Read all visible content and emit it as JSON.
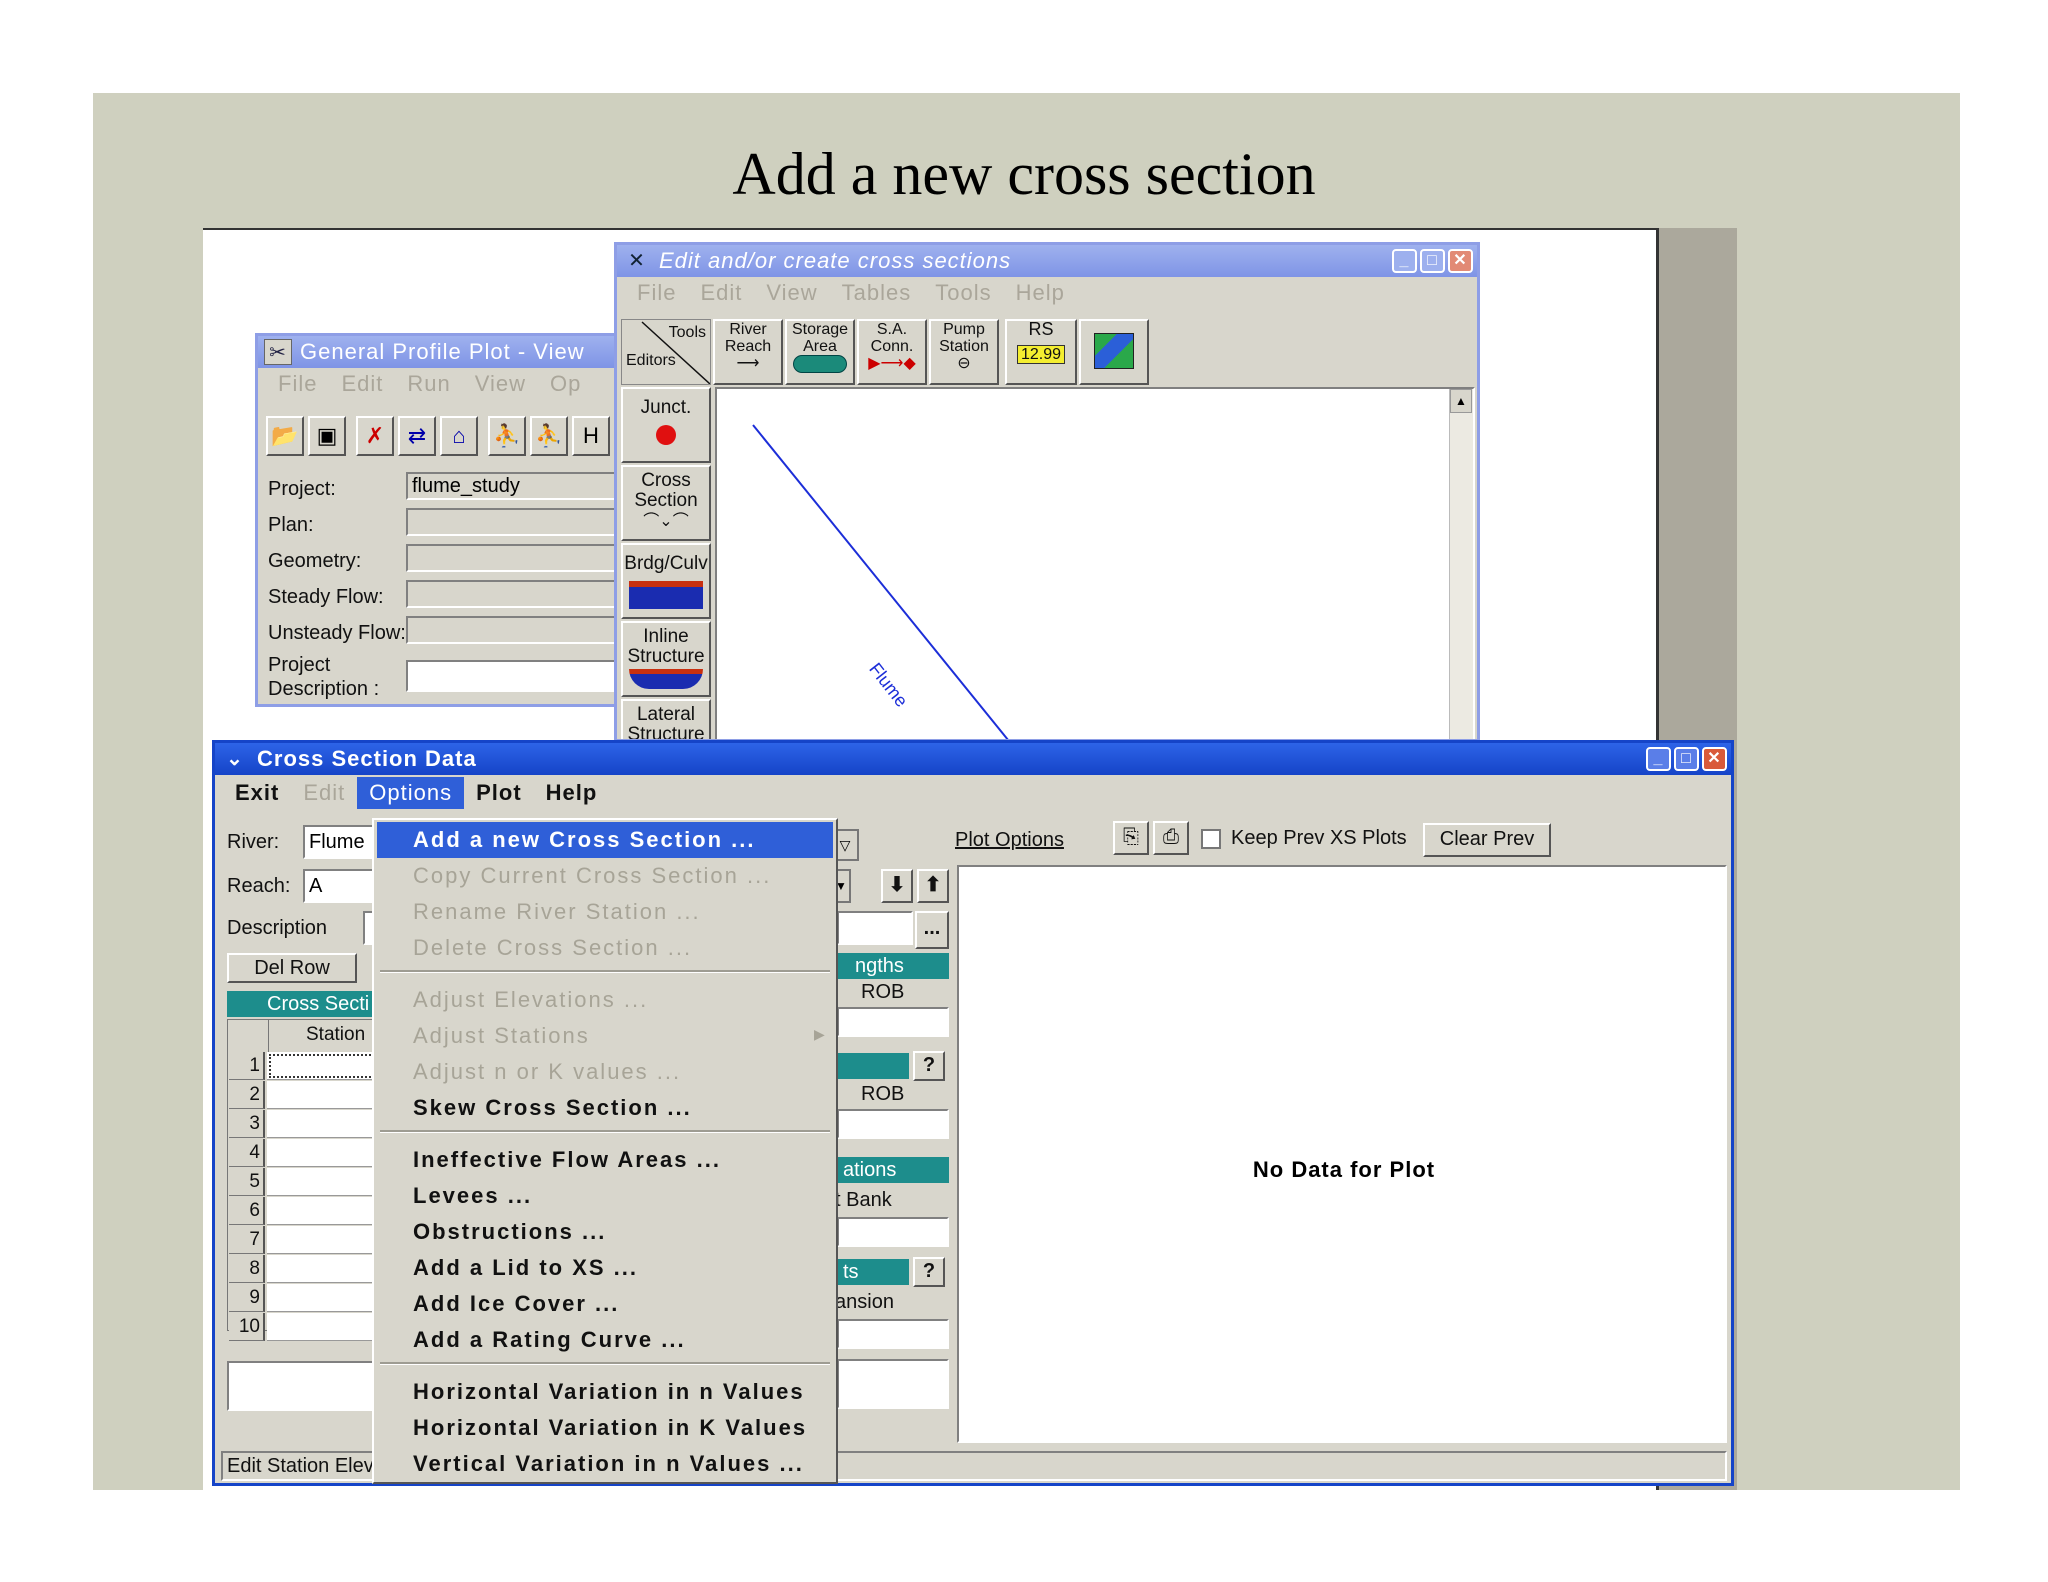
{
  "slide": {
    "title": "Add a new cross section"
  },
  "gpp": {
    "title": "General Profile Plot - View",
    "menu": [
      "File",
      "Edit",
      "Run",
      "View",
      "Op"
    ],
    "labels": {
      "project": "Project:",
      "plan": "Plan:",
      "geometry": "Geometry:",
      "steady": "Steady Flow:",
      "unsteady": "Unsteady Flow:",
      "desc1": "Project",
      "desc2": "Description :"
    },
    "project_value": "flume_study",
    "h_btn": "H"
  },
  "ecs": {
    "title": "Edit and/or create cross sections",
    "menu": [
      "File",
      "Edit",
      "View",
      "Tables",
      "Tools",
      "Help"
    ],
    "tools_label": "Tools",
    "editors_label": "Editors",
    "buttons": {
      "river1": "River",
      "river2": "Reach",
      "storage1": "Storage",
      "storage2": "Area",
      "sa1": "S.A.",
      "sa2": "Conn.",
      "pump1": "Pump",
      "pump2": "Station",
      "rs1": "RS",
      "rs2": "12.99"
    },
    "side": {
      "junct": "Junct.",
      "xs1": "Cross",
      "xs2": "Section",
      "brdg": "Brdg/Culv",
      "inline1": "Inline",
      "inline2": "Structure",
      "lateral1": "Lateral",
      "lateral2": "Structure"
    },
    "river_label": "Flume"
  },
  "xsd": {
    "title": "Cross Section Data",
    "menu": {
      "exit": "Exit",
      "edit": "Edit",
      "options": "Options",
      "plot": "Plot",
      "help": "Help"
    },
    "labels": {
      "river": "River:",
      "reach": "Reach:",
      "description": "Description"
    },
    "river_value": "Flume",
    "reach_value": "A",
    "del_row": "Del Row",
    "xs_header": "Cross Secti",
    "station_header": "Station",
    "rows": [
      "1",
      "2",
      "3",
      "4",
      "5",
      "6",
      "7",
      "8",
      "9",
      "10"
    ],
    "partial": {
      "lengths": "ngths",
      "rob1": "ROB",
      "rob2": "ROB",
      "ations": "ations",
      "bank": "t Bank",
      "ts": "ts",
      "ansion": "ansion",
      "q1": "?",
      "q2": "?",
      "dots": "..."
    },
    "plot_options": "Plot Options",
    "keep_prev": "Keep Prev XS Plots",
    "clear_prev": "Clear Prev",
    "no_data": "No Data for Plot",
    "status": "Edit Station Elev"
  },
  "options_menu": {
    "items": [
      {
        "label": "Add a new Cross Section ...",
        "state": "highlighted"
      },
      {
        "label": "Copy Current Cross Section ...",
        "state": "disabled"
      },
      {
        "label": "Rename River Station ...",
        "state": "disabled"
      },
      {
        "label": "Delete Cross Section ...",
        "state": "disabled"
      },
      {
        "label": "Adjust Elevations ...",
        "state": "disabled"
      },
      {
        "label": "Adjust Stations",
        "state": "disabled"
      },
      {
        "label": "Adjust n or K values ...",
        "state": "disabled"
      },
      {
        "label": "Skew Cross Section ...",
        "state": "enabled"
      },
      {
        "label": "Ineffective Flow Areas ...",
        "state": "enabled"
      },
      {
        "label": "Levees ...",
        "state": "enabled"
      },
      {
        "label": "Obstructions ...",
        "state": "enabled"
      },
      {
        "label": "Add a Lid to XS ...",
        "state": "enabled"
      },
      {
        "label": "Add Ice Cover ...",
        "state": "enabled"
      },
      {
        "label": "Add a Rating Curve ...",
        "state": "enabled"
      },
      {
        "label": "Horizontal Variation in n Values",
        "state": "enabled"
      },
      {
        "label": "Horizontal Variation in K Values",
        "state": "enabled"
      },
      {
        "label": "Vertical Variation in n Values ...",
        "state": "enabled"
      }
    ]
  }
}
